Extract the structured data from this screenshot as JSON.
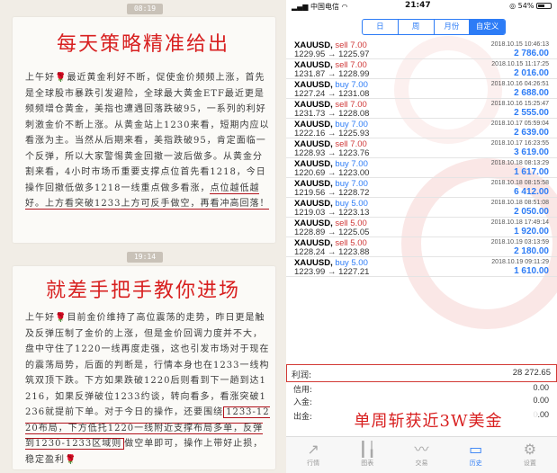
{
  "left": {
    "card1": {
      "pill": "08:19",
      "heading": "每天策略精准给出",
      "text_plain": "上午好🌹最近黄金利好不断，促使金价频频上涨，首先是全球股市暴跌引发避险，全球最大黄金ETF最近更是频频增仓黄金，美指也遭遇回落跌破95，一系列的利好刺激金价不断上涨。从黄金站上1230来看，短期内应以看涨为主。当然从后期来看，美指跌破95，肯定面临一个反弹，所以大家警惕黄金回撤一波后做多。从黄金分割来看，4小时市场币重要支撑点位首先看1218，今日操作回撤低做多1218一线重点做多看涨，",
      "text_underlined": "点位越低越好。上方看突破1233上方可反手做空，再看冲高回落！"
    },
    "card2": {
      "pill": "19:14",
      "heading": "就差手把手教你进场",
      "text_plain": "上午好🌹目前金价维持了高位震荡的走势，昨日更是触及反弹压制了金价的上涨，但是金价回调力度并不大，盘中守住了1220一线再度走强，这也引发市场对于现在的震荡局势，后面的判断是，行情本身也在1233一线构筑双顶下跌。下方如果跌破1220后则看到下一趟到达1216，如果反弹破位1233约谈，转向看多，看涨突破1236就提前下单。对于今日的操作，还要围绕",
      "text_boxed": "1233-1220布局，下方低托1220一线附近支撑布局多单，反弹到1230-1233区域则",
      "text_tail": "做空单即可，操作上带好止损，稳定盈利🌹"
    }
  },
  "status": {
    "carrier": "中国电信",
    "time": "21:47",
    "battery": "54%"
  },
  "segment": [
    "日",
    "周",
    "月份",
    "自定义"
  ],
  "trades": [
    {
      "symbol": "XAUUSD,",
      "side": "sell 7.00",
      "prices": "1229.95 → 1225.97",
      "date": "2018.10.15 10:46:13",
      "profit": "2 786.00"
    },
    {
      "symbol": "XAUUSD,",
      "side": "sell 7.00",
      "prices": "1231.87 → 1228.99",
      "date": "2018.10.15 11:17:25",
      "profit": "2 016.00"
    },
    {
      "symbol": "XAUUSD,",
      "side": "buy 7.00",
      "prices": "1227.24 → 1231.08",
      "date": "2018.10.16 04:26:51",
      "profit": "2 688.00"
    },
    {
      "symbol": "XAUUSD,",
      "side": "sell 7.00",
      "prices": "1231.73 → 1228.08",
      "date": "2018.10.16 15:25:47",
      "profit": "2 555.00"
    },
    {
      "symbol": "XAUUSD,",
      "side": "buy 7.00",
      "prices": "1222.16 → 1225.93",
      "date": "2018.10.17 05:59:04",
      "profit": "2 639.00"
    },
    {
      "symbol": "XAUUSD,",
      "side": "sell 7.00",
      "prices": "1228.93 → 1223.76",
      "date": "2018.10.17 16:23:55",
      "profit": "3 619.00"
    },
    {
      "symbol": "XAUUSD,",
      "side": "buy 7.00",
      "prices": "1220.69 → 1223.00",
      "date": "2018.10.18 08:13:29",
      "profit": "1 617.00"
    },
    {
      "symbol": "XAUUSD,",
      "side": "buy 7.00",
      "prices": "1219.56 → 1228.72",
      "date": "2018.10.18 08:15:58",
      "profit": "6 412.00"
    },
    {
      "symbol": "XAUUSD,",
      "side": "buy 5.00",
      "prices": "1219.03 → 1223.13",
      "date": "2018.10.18 08:51:08",
      "profit": "2 050.00"
    },
    {
      "symbol": "XAUUSD,",
      "side": "sell 5.00",
      "prices": "1228.89 → 1225.05",
      "date": "2018.10.18 17:49:14",
      "profit": "1 920.00"
    },
    {
      "symbol": "XAUUSD,",
      "side": "sell 5.00",
      "prices": "1228.24 → 1223.88",
      "date": "2018.10.19 03:13:59",
      "profit": "2 180.00"
    },
    {
      "symbol": "XAUUSD,",
      "side": "buy 5.00",
      "prices": "1223.99 → 1227.21",
      "date": "2018.10.19 09:11:29",
      "profit": "1 610.00"
    }
  ],
  "summary": {
    "profit_label": "利润:",
    "profit_value": "28 272.65",
    "credit_label": "信用:",
    "credit_value": "0.00",
    "deposit_label": "入金:",
    "deposit_value": "0.00",
    "withdraw_label": "出金:",
    "withdraw_value": "0.00"
  },
  "banner": "单周斩获近3W美金",
  "tabs": [
    {
      "label": "行情",
      "icon": "trend-icon"
    },
    {
      "label": "图表",
      "icon": "candles-icon"
    },
    {
      "label": "交易",
      "icon": "chart-line-icon"
    },
    {
      "label": "历史",
      "icon": "inbox-icon"
    },
    {
      "label": "设置",
      "icon": "gear-icon"
    }
  ],
  "colors": {
    "accent": "#2d7cf6",
    "sell": "#d03a3a",
    "heading_red": "#d82020"
  }
}
